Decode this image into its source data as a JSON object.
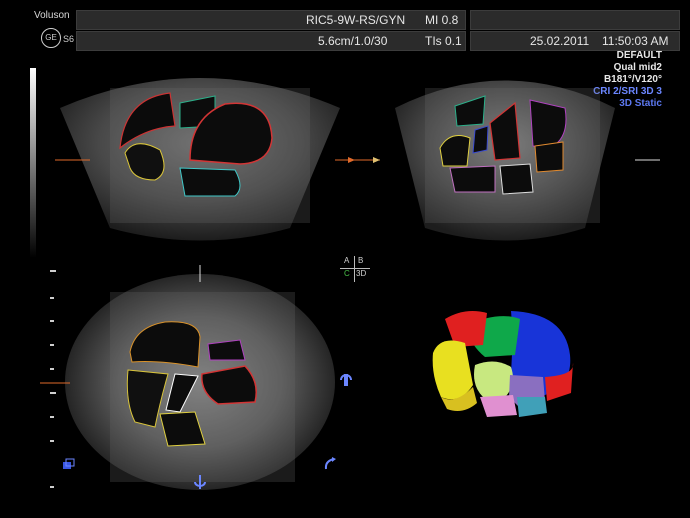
{
  "header": {
    "brand": "Voluson",
    "model": "S6",
    "ge_logo": "GE",
    "probe": "RIC5-9W-RS/GYN",
    "mi": "MI  0.8",
    "depth": "5.6cm/1.0/30",
    "tis": "TIs  0.1",
    "date": "25.02.2011",
    "time": "11:50:03 AM"
  },
  "settings": {
    "preset": "DEFAULT",
    "quality": "Qual mid2",
    "angles": "B181°/V120°",
    "cri": "CRI 2/SRI 3D 3",
    "mode": "3D Static"
  },
  "quad_selector": {
    "a": "A",
    "b": "B",
    "c": "C",
    "d": "3D"
  },
  "icons": {
    "rotate_right": "rotate-icon",
    "cube": "cube-icon",
    "rotate_bottom": "rotate-axis-icon",
    "rotate_corner": "rotate-curve-icon"
  },
  "colors": {
    "accent_blue": "#6b86ff",
    "marker_orange": "#e06a2a"
  }
}
